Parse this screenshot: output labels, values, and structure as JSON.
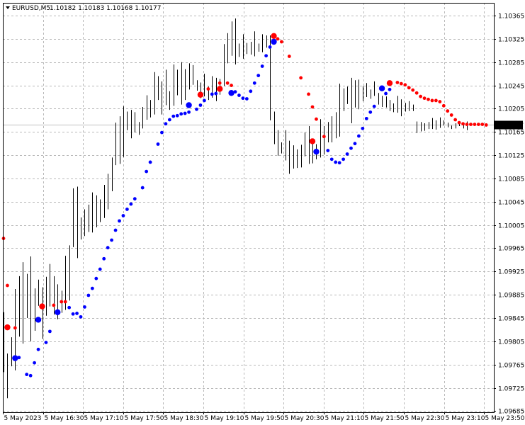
{
  "header": {
    "symbol": "EURUSD,M5",
    "ohlc": "1.10182 1.10183 1.10168 1.10177"
  },
  "price_label": "1.10177",
  "colors": {
    "background": "#ffffff",
    "grid": "#b8b8b8",
    "axis": "#000000",
    "bars": "#000000",
    "current_price_line": "#c0c0c0",
    "price_label_bg": "#000000",
    "price_label_text": "#ffffff",
    "dot_red": "#ff0000",
    "dot_blue": "#0000ff"
  },
  "chart_data": {
    "type": "scatter",
    "title": "",
    "y_ticks": [
      "1.10365",
      "1.10325",
      "1.10285",
      "1.10245",
      "1.10205",
      "1.10165",
      "1.10125",
      "1.10085",
      "1.10045",
      "1.10005",
      "1.09965",
      "1.09925",
      "1.09885",
      "1.09845",
      "1.09805",
      "1.09765",
      "1.09725",
      "1.09685"
    ],
    "ylim": [
      1.09683,
      1.10387
    ],
    "current_price": 1.10177,
    "x_ticks": [
      "5 May 2023",
      "5 May 16:30",
      "5 May 17:10",
      "5 May 17:50",
      "5 May 18:30",
      "5 May 19:10",
      "5 May 19:50",
      "5 May 20:30",
      "5 May 21:10",
      "5 May 21:50",
      "5 May 22:30",
      "5 May 23:10",
      "5 May 23:50"
    ],
    "grid": true,
    "bars": [
      {
        "h": 1.09855,
        "l": 1.09752
      },
      {
        "h": 1.09784,
        "l": 1.09707
      },
      {
        "h": 1.09812,
        "l": 1.09762
      },
      {
        "h": 1.09895,
        "l": 1.09755
      },
      {
        "h": 1.09917,
        "l": 1.09813
      },
      {
        "h": 1.09941,
        "l": 1.09801
      },
      {
        "h": 1.09921,
        "l": 1.09845
      },
      {
        "h": 1.09951,
        "l": 1.09805
      },
      {
        "h": 1.09896,
        "l": 1.09823
      },
      {
        "h": 1.09911,
        "l": 1.09866
      },
      {
        "h": 1.09898,
        "l": 1.09809
      },
      {
        "h": 1.09916,
        "l": 1.09849
      },
      {
        "h": 1.09938,
        "l": 1.09865
      },
      {
        "h": 1.09917,
        "l": 1.09851
      },
      {
        "h": 1.09903,
        "l": 1.09843
      },
      {
        "h": 1.09892,
        "l": 1.09854
      },
      {
        "h": 1.09952,
        "l": 1.09859
      },
      {
        "h": 1.0997,
        "l": 1.09875
      },
      {
        "h": 1.10068,
        "l": 1.09967
      },
      {
        "h": 1.10071,
        "l": 1.09948
      },
      {
        "h": 1.10018,
        "l": 1.0998
      },
      {
        "h": 1.10032,
        "l": 1.09986
      },
      {
        "h": 1.1004,
        "l": 1.09993
      },
      {
        "h": 1.10061,
        "l": 1.09992
      },
      {
        "h": 1.10056,
        "l": 1.10001
      },
      {
        "h": 1.10049,
        "l": 1.1001
      },
      {
        "h": 1.10074,
        "l": 1.10017
      },
      {
        "h": 1.10093,
        "l": 1.10032
      },
      {
        "h": 1.10121,
        "l": 1.10063
      },
      {
        "h": 1.10181,
        "l": 1.10108
      },
      {
        "h": 1.10192,
        "l": 1.1011
      },
      {
        "h": 1.10209,
        "l": 1.10122
      },
      {
        "h": 1.102,
        "l": 1.10168
      },
      {
        "h": 1.10203,
        "l": 1.10154
      },
      {
        "h": 1.10199,
        "l": 1.10164
      },
      {
        "h": 1.10182,
        "l": 1.1016
      },
      {
        "h": 1.10208,
        "l": 1.10171
      },
      {
        "h": 1.10228,
        "l": 1.10186
      },
      {
        "h": 1.1022,
        "l": 1.1019
      },
      {
        "h": 1.10268,
        "l": 1.10195
      },
      {
        "h": 1.10261,
        "l": 1.1022
      },
      {
        "h": 1.10252,
        "l": 1.10195
      },
      {
        "h": 1.10272,
        "l": 1.10211
      },
      {
        "h": 1.10235,
        "l": 1.10203
      },
      {
        "h": 1.10281,
        "l": 1.1021
      },
      {
        "h": 1.10272,
        "l": 1.10228
      },
      {
        "h": 1.10285,
        "l": 1.10212
      },
      {
        "h": 1.10273,
        "l": 1.1022
      },
      {
        "h": 1.10283,
        "l": 1.10238
      },
      {
        "h": 1.1028,
        "l": 1.10246
      },
      {
        "h": 1.10254,
        "l": 1.10236
      },
      {
        "h": 1.1025,
        "l": 1.10223
      },
      {
        "h": 1.10265,
        "l": 1.10226
      },
      {
        "h": 1.10243,
        "l": 1.1022
      },
      {
        "h": 1.10261,
        "l": 1.10224
      },
      {
        "h": 1.10258,
        "l": 1.10218
      },
      {
        "h": 1.10256,
        "l": 1.10229
      },
      {
        "h": 1.10316,
        "l": 1.10244
      },
      {
        "h": 1.10335,
        "l": 1.10283
      },
      {
        "h": 1.10355,
        "l": 1.10296
      },
      {
        "h": 1.1036,
        "l": 1.10281
      },
      {
        "h": 1.10317,
        "l": 1.10294
      },
      {
        "h": 1.10333,
        "l": 1.10291
      },
      {
        "h": 1.10318,
        "l": 1.10299
      },
      {
        "h": 1.1032,
        "l": 1.10298
      },
      {
        "h": 1.10338,
        "l": 1.10295
      },
      {
        "h": 1.10317,
        "l": 1.10303
      },
      {
        "h": 1.10333,
        "l": 1.10302
      },
      {
        "h": 1.10331,
        "l": 1.1031
      },
      {
        "h": 1.10331,
        "l": 1.10185
      },
      {
        "h": 1.102,
        "l": 1.10144
      },
      {
        "h": 1.10168,
        "l": 1.10124
      },
      {
        "h": 1.10147,
        "l": 1.10128
      },
      {
        "h": 1.10168,
        "l": 1.10116
      },
      {
        "h": 1.1015,
        "l": 1.10093
      },
      {
        "h": 1.10142,
        "l": 1.10102
      },
      {
        "h": 1.10135,
        "l": 1.10103
      },
      {
        "h": 1.10143,
        "l": 1.10104
      },
      {
        "h": 1.10164,
        "l": 1.10123
      },
      {
        "h": 1.10175,
        "l": 1.1011
      },
      {
        "h": 1.1015,
        "l": 1.10111
      },
      {
        "h": 1.10144,
        "l": 1.10118
      },
      {
        "h": 1.10187,
        "l": 1.10121
      },
      {
        "h": 1.10175,
        "l": 1.10126
      },
      {
        "h": 1.10182,
        "l": 1.10147
      },
      {
        "h": 1.10192,
        "l": 1.10147
      },
      {
        "h": 1.10199,
        "l": 1.10154
      },
      {
        "h": 1.10248,
        "l": 1.10157
      },
      {
        "h": 1.1024,
        "l": 1.10201
      },
      {
        "h": 1.10243,
        "l": 1.10213
      },
      {
        "h": 1.10258,
        "l": 1.1018
      },
      {
        "h": 1.10254,
        "l": 1.10207
      },
      {
        "h": 1.10255,
        "l": 1.10204
      },
      {
        "h": 1.10244,
        "l": 1.10218
      },
      {
        "h": 1.10249,
        "l": 1.10225
      },
      {
        "h": 1.10238,
        "l": 1.10222
      },
      {
        "h": 1.10252,
        "l": 1.10227
      },
      {
        "h": 1.10232,
        "l": 1.10212
      },
      {
        "h": 1.10227,
        "l": 1.10208
      },
      {
        "h": 1.10226,
        "l": 1.10207
      },
      {
        "h": 1.1022,
        "l": 1.10201
      },
      {
        "h": 1.10214,
        "l": 1.10199
      },
      {
        "h": 1.10227,
        "l": 1.10198
      },
      {
        "h": 1.10221,
        "l": 1.10192
      },
      {
        "h": 1.10215,
        "l": 1.102
      },
      {
        "h": 1.10218,
        "l": 1.10201
      },
      {
        "h": 1.10212,
        "l": 1.10201
      },
      {
        "h": 1.10183,
        "l": 1.10163
      },
      {
        "h": 1.10182,
        "l": 1.10166
      },
      {
        "h": 1.1018,
        "l": 1.10167
      },
      {
        "h": 1.10182,
        "l": 1.1017
      },
      {
        "h": 1.10189,
        "l": 1.1017
      },
      {
        "h": 1.10185,
        "l": 1.10169
      },
      {
        "h": 1.1019,
        "l": 1.10172
      },
      {
        "h": 1.10185,
        "l": 1.10176
      },
      {
        "h": 1.10181,
        "l": 1.10173
      },
      {
        "h": 1.10176,
        "l": 1.1017
      },
      {
        "h": 1.1018,
        "l": 1.10171
      },
      {
        "h": 1.10179,
        "l": 1.10175
      },
      {
        "h": 1.10179,
        "l": 1.10171
      },
      {
        "h": 1.10183,
        "l": 1.10168
      }
    ],
    "series": [
      {
        "color": "red",
        "points": [
          [
            0,
            1.09982
          ],
          [
            1,
            1.09901
          ],
          [
            3,
            1.09828
          ],
          [
            13,
            1.09867
          ],
          [
            15,
            1.09873
          ],
          [
            16,
            1.09873
          ],
          [
            53,
            1.10239
          ],
          [
            56,
            1.10249
          ],
          [
            58,
            1.10249
          ],
          [
            59,
            1.10245
          ],
          [
            70,
            1.1033
          ],
          [
            71,
            1.10325
          ],
          [
            72,
            1.1032
          ],
          [
            74,
            1.10295
          ],
          [
            77,
            1.10258
          ],
          [
            79,
            1.1023
          ],
          [
            80,
            1.10208
          ],
          [
            81,
            1.10187
          ],
          [
            83,
            1.10157
          ],
          [
            102,
            1.1025
          ],
          [
            103,
            1.10248
          ],
          [
            104,
            1.10246
          ],
          [
            105,
            1.10241
          ],
          [
            106,
            1.10237
          ],
          [
            107,
            1.10232
          ],
          [
            108,
            1.10226
          ],
          [
            109,
            1.10223
          ],
          [
            110,
            1.10221
          ],
          [
            111,
            1.10219
          ],
          [
            112,
            1.10219
          ],
          [
            113,
            1.10217
          ],
          [
            114,
            1.1021
          ],
          [
            115,
            1.10201
          ],
          [
            116,
            1.10194
          ],
          [
            117,
            1.10186
          ],
          [
            118,
            1.10181
          ],
          [
            119,
            1.10179
          ],
          [
            120,
            1.10178
          ],
          [
            121,
            1.10178
          ],
          [
            122,
            1.10178
          ],
          [
            123,
            1.10178
          ],
          [
            124,
            1.10178
          ],
          [
            125,
            1.10177
          ]
        ]
      },
      {
        "color": "blue",
        "points": [
          [
            4,
            1.09777
          ],
          [
            6,
            1.09748
          ],
          [
            7,
            1.09746
          ],
          [
            8,
            1.09768
          ],
          [
            9,
            1.09791
          ],
          [
            11,
            1.09803
          ],
          [
            12,
            1.09822
          ],
          [
            17,
            1.09863
          ],
          [
            18,
            1.09852
          ],
          [
            19,
            1.09853
          ],
          [
            20,
            1.09847
          ],
          [
            21,
            1.09864
          ],
          [
            22,
            1.09884
          ],
          [
            23,
            1.09896
          ],
          [
            24,
            1.09913
          ],
          [
            25,
            1.09929
          ],
          [
            26,
            1.09947
          ],
          [
            27,
            1.09966
          ],
          [
            28,
            1.09979
          ],
          [
            29,
            1.09996
          ],
          [
            30,
            1.10012
          ],
          [
            31,
            1.10021
          ],
          [
            32,
            1.10032
          ],
          [
            33,
            1.10041
          ],
          [
            34,
            1.1005
          ],
          [
            36,
            1.10069
          ],
          [
            37,
            1.10097
          ],
          [
            38,
            1.10113
          ],
          [
            40,
            1.10144
          ],
          [
            41,
            1.10164
          ],
          [
            42,
            1.10179
          ],
          [
            43,
            1.10186
          ],
          [
            44,
            1.10192
          ],
          [
            45,
            1.10193
          ],
          [
            46,
            1.10196
          ],
          [
            47,
            1.10197
          ],
          [
            48,
            1.10199
          ],
          [
            50,
            1.10204
          ],
          [
            51,
            1.10211
          ],
          [
            52,
            1.10219
          ],
          [
            54,
            1.1023
          ],
          [
            55,
            1.10231
          ],
          [
            60,
            1.10234
          ],
          [
            61,
            1.10228
          ],
          [
            62,
            1.10223
          ],
          [
            63,
            1.10222
          ],
          [
            64,
            1.10235
          ],
          [
            65,
            1.10249
          ],
          [
            66,
            1.10262
          ],
          [
            67,
            1.10278
          ],
          [
            68,
            1.10296
          ],
          [
            69,
            1.10311
          ],
          [
            84,
            1.10133
          ],
          [
            85,
            1.10118
          ],
          [
            86,
            1.10113
          ],
          [
            87,
            1.10112
          ],
          [
            88,
            1.10118
          ],
          [
            89,
            1.10127
          ],
          [
            90,
            1.10137
          ],
          [
            91,
            1.10145
          ],
          [
            92,
            1.10158
          ],
          [
            93,
            1.10171
          ],
          [
            94,
            1.10188
          ],
          [
            95,
            1.10199
          ],
          [
            96,
            1.10209
          ],
          [
            99,
            1.10231
          ],
          [
            100,
            1.10238
          ]
        ]
      },
      {
        "color": "red",
        "size": "large",
        "points": [
          [
            1,
            1.09829
          ],
          [
            10,
            1.09865
          ],
          [
            51,
            1.10229
          ],
          [
            56,
            1.10239
          ],
          [
            70,
            1.1033
          ],
          [
            80,
            1.10149
          ],
          [
            100,
            1.10249
          ]
        ]
      },
      {
        "color": "blue",
        "size": "large",
        "points": [
          [
            3,
            1.09776
          ],
          [
            9,
            1.09842
          ],
          [
            14,
            1.09855
          ],
          [
            48,
            1.10211
          ],
          [
            59,
            1.10232
          ],
          [
            70,
            1.1032
          ],
          [
            81,
            1.10131
          ],
          [
            98,
            1.1024
          ]
        ]
      }
    ]
  }
}
